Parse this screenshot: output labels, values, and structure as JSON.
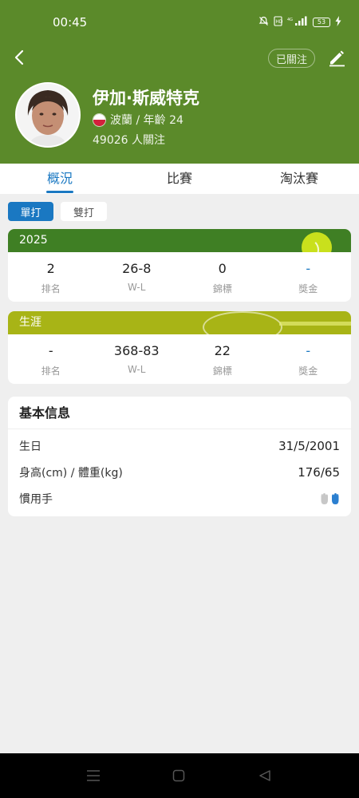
{
  "status_bar": {
    "time": "00:45",
    "battery": "53"
  },
  "header": {
    "follow_label": "已關注",
    "player_name": "伊加·斯威特克",
    "meta": "波蘭 / 年齡 24",
    "followers": "49026 人關注"
  },
  "tabs": [
    {
      "label": "概況",
      "active": true
    },
    {
      "label": "比賽",
      "active": false
    },
    {
      "label": "淘汰賽",
      "active": false
    }
  ],
  "type_toggle": {
    "singles": "單打",
    "doubles": "雙打",
    "selected": "單打"
  },
  "season": {
    "title": "2025",
    "stats": [
      {
        "value": "2",
        "label": "排名"
      },
      {
        "value": "26-8",
        "label": "W-L"
      },
      {
        "value": "0",
        "label": "錦標"
      },
      {
        "value": "-",
        "label": "獎金"
      }
    ]
  },
  "career": {
    "title": "生涯",
    "stats": [
      {
        "value": "-",
        "label": "排名"
      },
      {
        "value": "368-83",
        "label": "W-L"
      },
      {
        "value": "22",
        "label": "錦標"
      },
      {
        "value": "-",
        "label": "獎金"
      }
    ]
  },
  "basic_info": {
    "title": "基本信息",
    "rows": [
      {
        "label": "生日",
        "value": "31/5/2001"
      },
      {
        "label": "身高(cm) / 體重(kg)",
        "value": "176/65"
      },
      {
        "label": "慣用手",
        "value": ""
      }
    ]
  },
  "colors": {
    "header_green": "#5b8a2a",
    "accent_blue": "#1a78c2",
    "season_green": "#3f7f24",
    "career_olive": "#a8b416"
  }
}
